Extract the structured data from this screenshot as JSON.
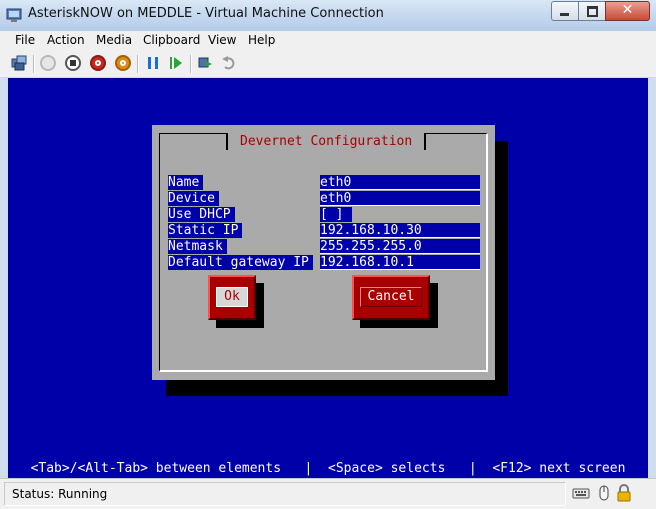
{
  "window": {
    "title": "AsteriskNOW on MEDDLE - Virtual Machine Connection",
    "close_glyph": "✕"
  },
  "menu": [
    "File",
    "Action",
    "Media",
    "Clipboard",
    "View",
    "Help"
  ],
  "toolbar": {
    "icons": [
      "ctrl-alt-del-icon",
      "start-icon",
      "turn-off-icon",
      "shut-down-icon",
      "save-icon",
      "pause-icon",
      "reset-icon",
      "snapshot-icon",
      "revert-icon"
    ],
    "colors": {
      "turn_off": "#c8281e",
      "shut_down": "#e08a10",
      "pause": "#1b6fd2",
      "reset": "#2aa33a"
    }
  },
  "console": {
    "background": "#0000a8",
    "dialog": {
      "title": "Devernet Configuration",
      "fields": [
        {
          "label": "Name",
          "value": "eth0"
        },
        {
          "label": "Device",
          "value": "eth0"
        },
        {
          "label": "Use DHCP",
          "value": "[ ]"
        },
        {
          "label": "Static IP",
          "value": "192.168.10.30"
        },
        {
          "label": "Netmask",
          "value": "255.255.255.0"
        },
        {
          "label": "Default gateway IP",
          "value": "192.168.10.1"
        }
      ],
      "ok_label": "Ok",
      "cancel_label": "Cancel"
    },
    "help_line": "<Tab>/<Alt-Tab> between elements   |  <Space> selects   |  <F12> next screen"
  },
  "status": {
    "text": "Status: Running",
    "icons": [
      "keyboard-icon",
      "mouse-capture-icon",
      "lock-icon"
    ]
  }
}
